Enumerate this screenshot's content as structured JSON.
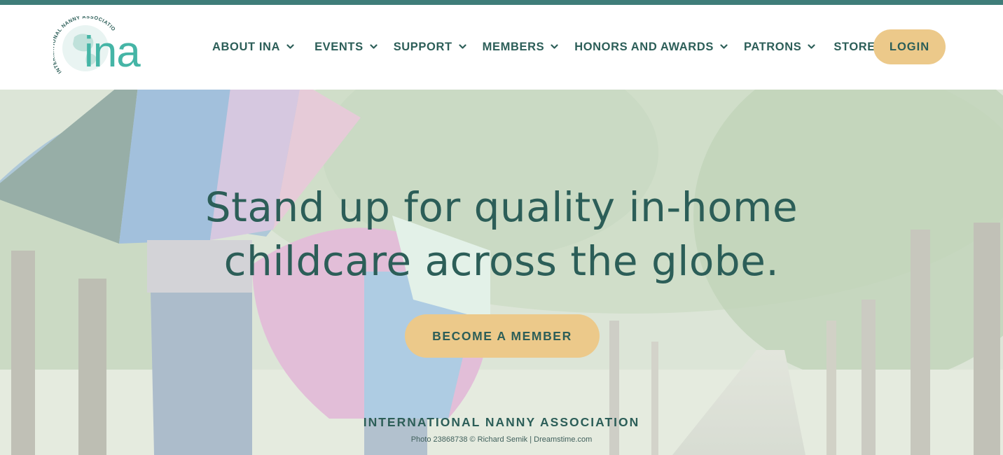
{
  "brand": {
    "logo_text": "ina",
    "logo_ring_text": "INTERNATIONAL NANNY ASSOCIATION",
    "colors": {
      "accent_teal": "#3f7d79",
      "logo_teal": "#45b5a6",
      "button_gold": "#ecc98a",
      "text_green": "#2c5e58"
    }
  },
  "nav": {
    "items": [
      {
        "label": "ABOUT INA",
        "has_dropdown": true
      },
      {
        "label": "EVENTS",
        "has_dropdown": true
      },
      {
        "label": "SUPPORT",
        "has_dropdown": true
      },
      {
        "label": "MEMBERS",
        "has_dropdown": true
      },
      {
        "label": "HONORS AND AWARDS",
        "has_dropdown": true
      },
      {
        "label": "PATRONS",
        "has_dropdown": true
      },
      {
        "label": "STORE",
        "has_dropdown": false
      }
    ],
    "login_label": "LOGIN",
    "dropdown_icon": "chevron-down-icon"
  },
  "hero": {
    "headline_line1": "Stand up for quality in-home",
    "headline_line2": "childcare across the globe.",
    "cta_label": "BECOME A MEMBER",
    "org_name": "INTERNATIONAL NANNY ASSOCIATION",
    "photo_credit": "Photo 23868738 © Richard Semik | Dreamstime.com"
  }
}
